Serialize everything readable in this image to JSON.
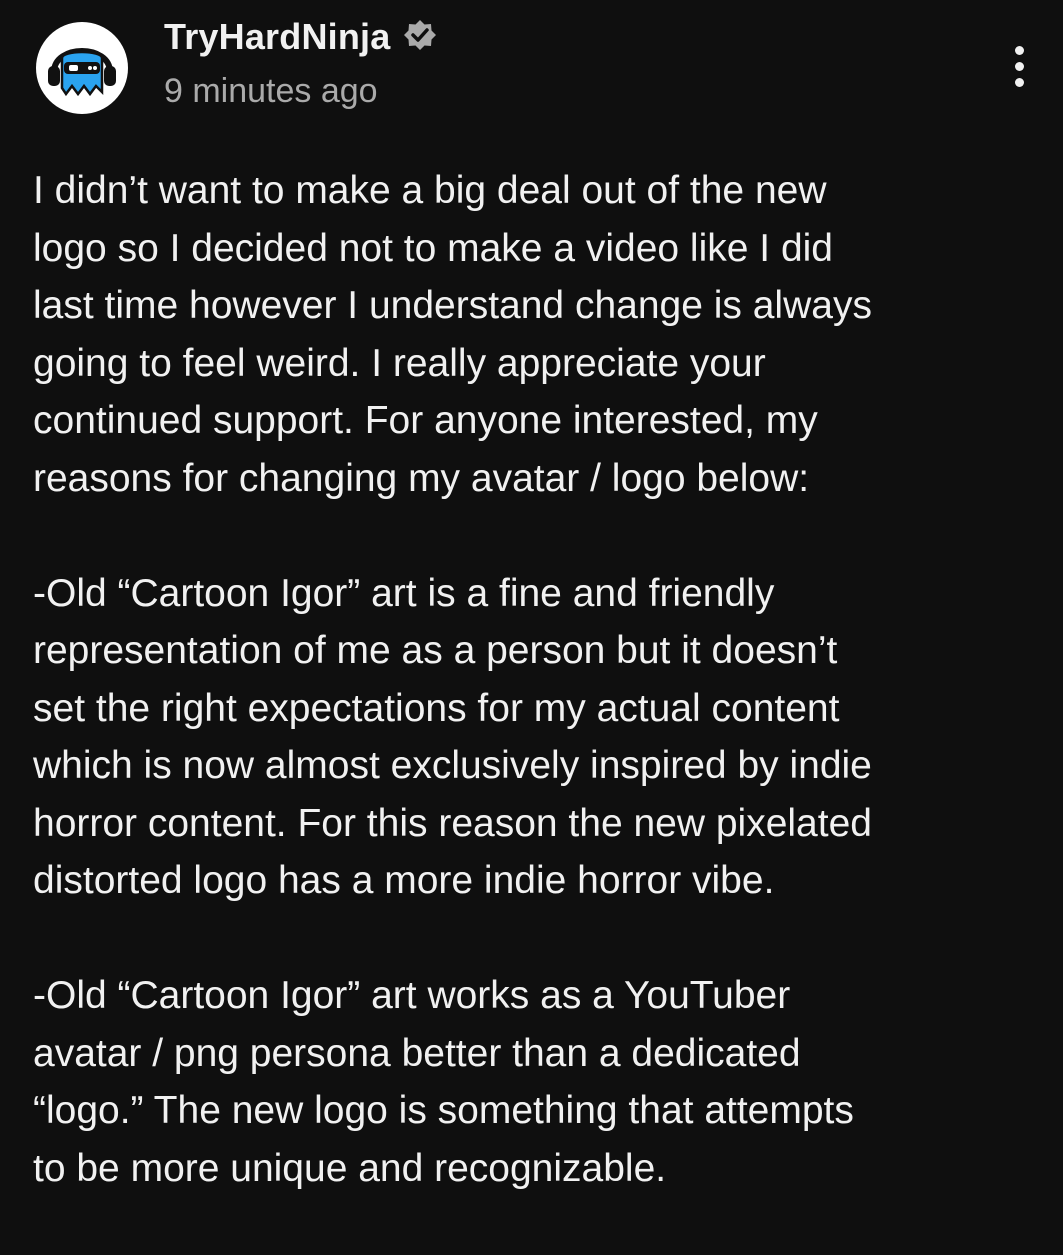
{
  "post": {
    "channel_name": "TryHardNinja",
    "timestamp": "9 minutes ago",
    "avatar_icon": "ninja-headphones-avatar",
    "verified_icon": "verified-badge-icon",
    "menu_icon": "more-vert-icon",
    "colors": {
      "background": "#0f0f0f",
      "text": "#f1f1f1",
      "secondary_text": "#aaaaaa",
      "avatar_blue": "#2aa3ef"
    },
    "paragraphs": [
      {
        "lines": [
          "I didn’t want to make a big deal out of the new",
          "logo so I decided not to make a video like I did",
          "last time however I understand change is always",
          "going to feel weird. I really appreciate your",
          "continued support. For anyone interested, my",
          "reasons for changing my avatar / logo below:"
        ]
      },
      {
        "lines": [
          "-Old “Cartoon Igor” art is a fine and friendly",
          "representation of me as a person but it doesn’t",
          "set the right expectations for my actual content",
          "which is now almost exclusively inspired by indie",
          "horror content. For this reason the new pixelated",
          "distorted logo has a more indie horror vibe."
        ]
      },
      {
        "lines": [
          "-Old “Cartoon Igor” art works as a YouTuber",
          "avatar / png persona better than a dedicated",
          "“logo.” The new logo is something that attempts",
          "to be more unique and recognizable."
        ]
      }
    ]
  }
}
